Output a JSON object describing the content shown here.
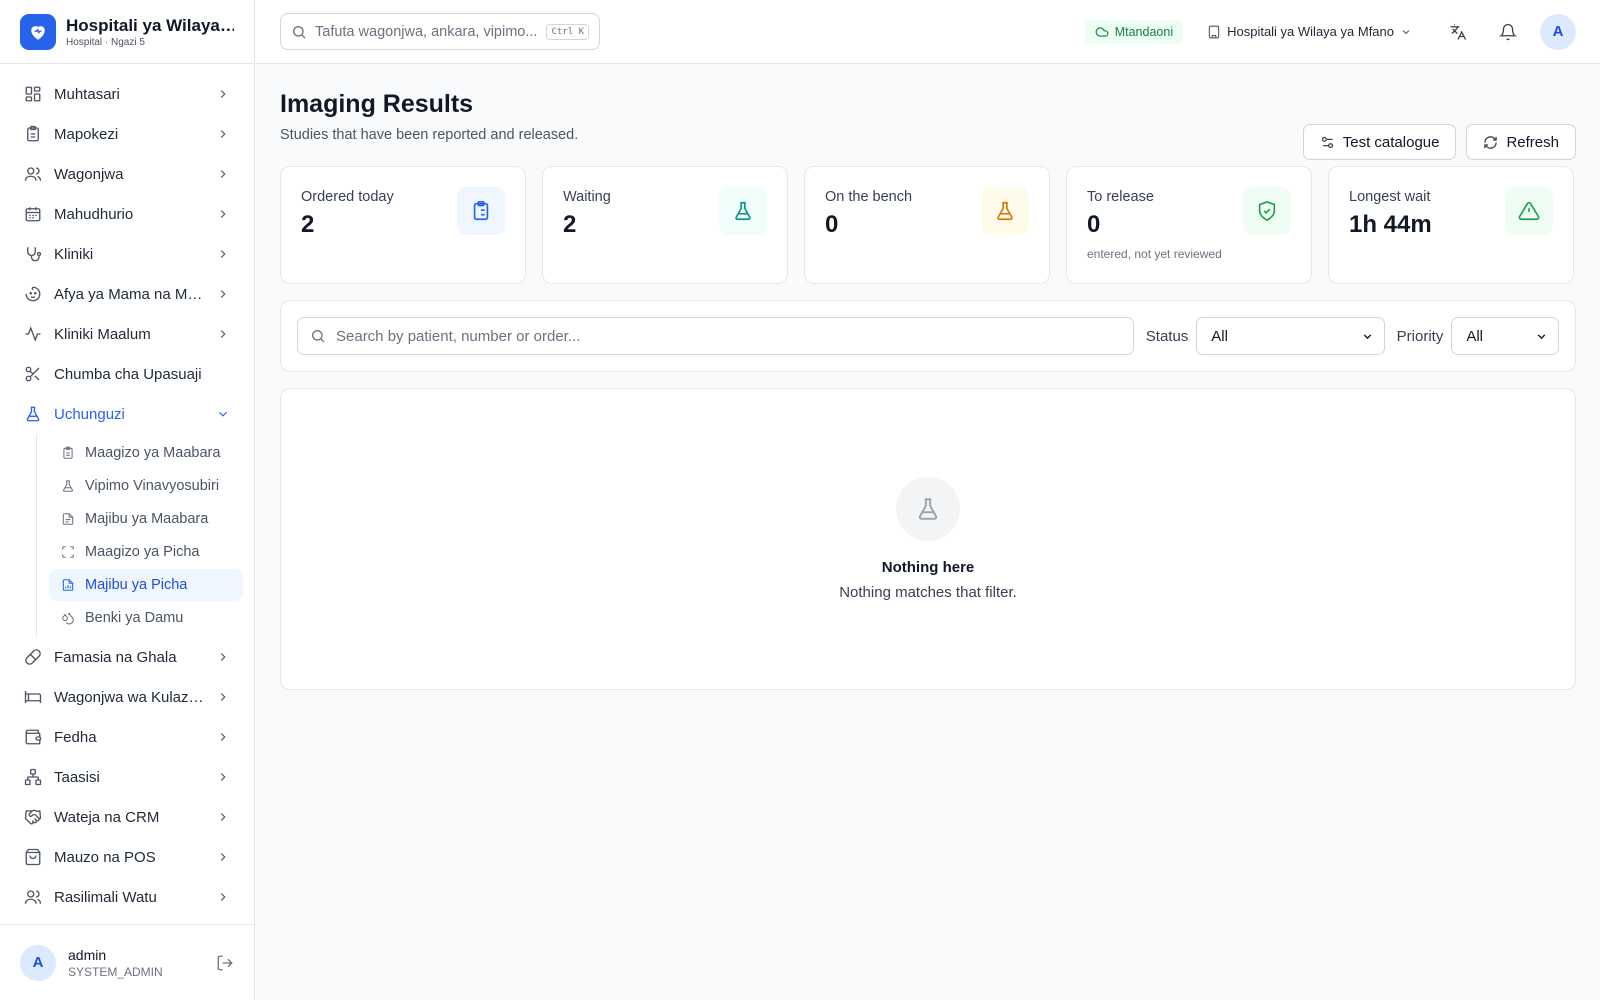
{
  "brand": {
    "title": "Hospitali ya Wilaya ya Mfano",
    "subtitle": "Hospital · Ngazi 5"
  },
  "sidebar": {
    "items": [
      {
        "label": "Muhtasari",
        "icon": "grid-icon"
      },
      {
        "label": "Mapokezi",
        "icon": "clipboard-icon"
      },
      {
        "label": "Wagonjwa",
        "icon": "users-icon"
      },
      {
        "label": "Mahudhurio",
        "icon": "calendar-icon"
      },
      {
        "label": "Kliniki",
        "icon": "stethoscope-icon"
      },
      {
        "label": "Afya ya Mama na Mtoto",
        "icon": "baby-icon"
      },
      {
        "label": "Kliniki Maalum",
        "icon": "activity-icon"
      },
      {
        "label": "Chumba cha Upasuaji",
        "icon": "scissors-icon"
      },
      {
        "label": "Uchunguzi",
        "icon": "flask-icon"
      }
    ],
    "subitems": [
      {
        "label": "Maagizo ya Maabara",
        "icon": "clipboard-icon"
      },
      {
        "label": "Vipimo Vinavyosubiri",
        "icon": "flask-icon"
      },
      {
        "label": "Majibu ya Maabara",
        "icon": "file-icon"
      },
      {
        "label": "Maagizo ya Picha",
        "icon": "scan-icon"
      },
      {
        "label": "Majibu ya Picha",
        "icon": "file-chart-icon"
      },
      {
        "label": "Benki ya Damu",
        "icon": "droplet-icon"
      }
    ],
    "items_after": [
      {
        "label": "Famasia na Ghala",
        "icon": "pill-icon"
      },
      {
        "label": "Wagonjwa wa Kulazwa",
        "icon": "bed-icon"
      },
      {
        "label": "Fedha",
        "icon": "wallet-icon"
      },
      {
        "label": "Taasisi",
        "icon": "network-icon"
      },
      {
        "label": "Wateja na CRM",
        "icon": "handshake-icon"
      },
      {
        "label": "Mauzo na POS",
        "icon": "shopping-bag-icon"
      },
      {
        "label": "Rasilimali Watu",
        "icon": "users-icon"
      }
    ],
    "user": {
      "initial": "A",
      "name": "admin",
      "role": "SYSTEM_ADMIN"
    }
  },
  "topbar": {
    "search_placeholder": "Tafuta wagonjwa, ankara, vipimo...",
    "shortcut": "Ctrl K",
    "status": "Mtandaoni",
    "facility": "Hospitali ya Wilaya ya Mfano",
    "avatar_initial": "A"
  },
  "page": {
    "title": "Imaging Results",
    "subtitle": "Studies that have been reported and released.",
    "test_catalogue_label": "Test catalogue",
    "refresh_label": "Refresh"
  },
  "stats": [
    {
      "label": "Ordered today",
      "value": "2",
      "note": "",
      "icon": "clipboard-list-icon",
      "color": "#2563eb",
      "bg": "#eff6ff"
    },
    {
      "label": "Waiting",
      "value": "2",
      "note": "",
      "icon": "flask-icon",
      "color": "#0d9488",
      "bg": "#f0fdfa"
    },
    {
      "label": "On the bench",
      "value": "0",
      "note": "",
      "icon": "flask-icon",
      "color": "#d97706",
      "bg": "#fffbeb"
    },
    {
      "label": "To release",
      "value": "0",
      "note": "entered, not yet reviewed",
      "icon": "shield-check-icon",
      "color": "#16a34a",
      "bg": "#f0fdf4"
    },
    {
      "label": "Longest wait",
      "value": "1h 44m",
      "note": "",
      "icon": "alert-triangle-icon",
      "color": "#16a34a",
      "bg": "#f0fdf4"
    }
  ],
  "filters": {
    "search_placeholder": "Search by patient, number or order...",
    "status_label": "Status",
    "status_value": "All",
    "priority_label": "Priority",
    "priority_value": "All"
  },
  "empty": {
    "title": "Nothing here",
    "message": "Nothing matches that filter."
  }
}
